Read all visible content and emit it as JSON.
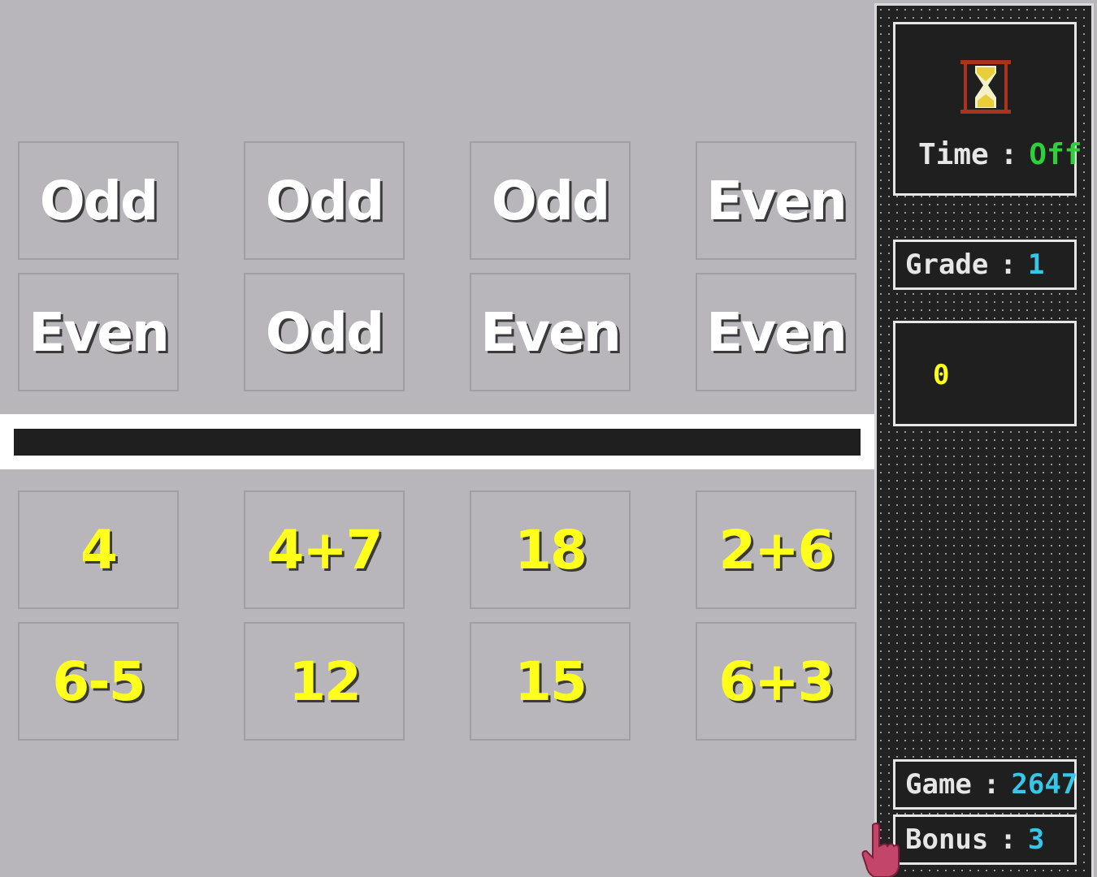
{
  "labels": [
    "Odd",
    "Odd",
    "Odd",
    "Even",
    "Even",
    "Odd",
    "Even",
    "Even"
  ],
  "expressions": [
    "4",
    "4+7",
    "18",
    "2+6",
    "6-5",
    "12",
    "15",
    "6+3"
  ],
  "panel": {
    "time_label": "Time",
    "time_value": "Off",
    "grade_label": "Grade",
    "grade_value": "1",
    "score_value": "0",
    "game_label": "Game",
    "game_value": "2647",
    "bonus_label": "Bonus",
    "bonus_value": "3",
    "separator": ":"
  },
  "icons": {
    "timer": "hourglass-icon",
    "pointer": "hand-cursor-icon"
  },
  "colors": {
    "background": "#b9b6bb",
    "label_text": "#ffffff",
    "expression_text": "#ffff1c",
    "time_value": "#2ed13b",
    "counter_value": "#36c6e8",
    "score_value": "#ffff1c",
    "panel_bg": "#222222"
  }
}
